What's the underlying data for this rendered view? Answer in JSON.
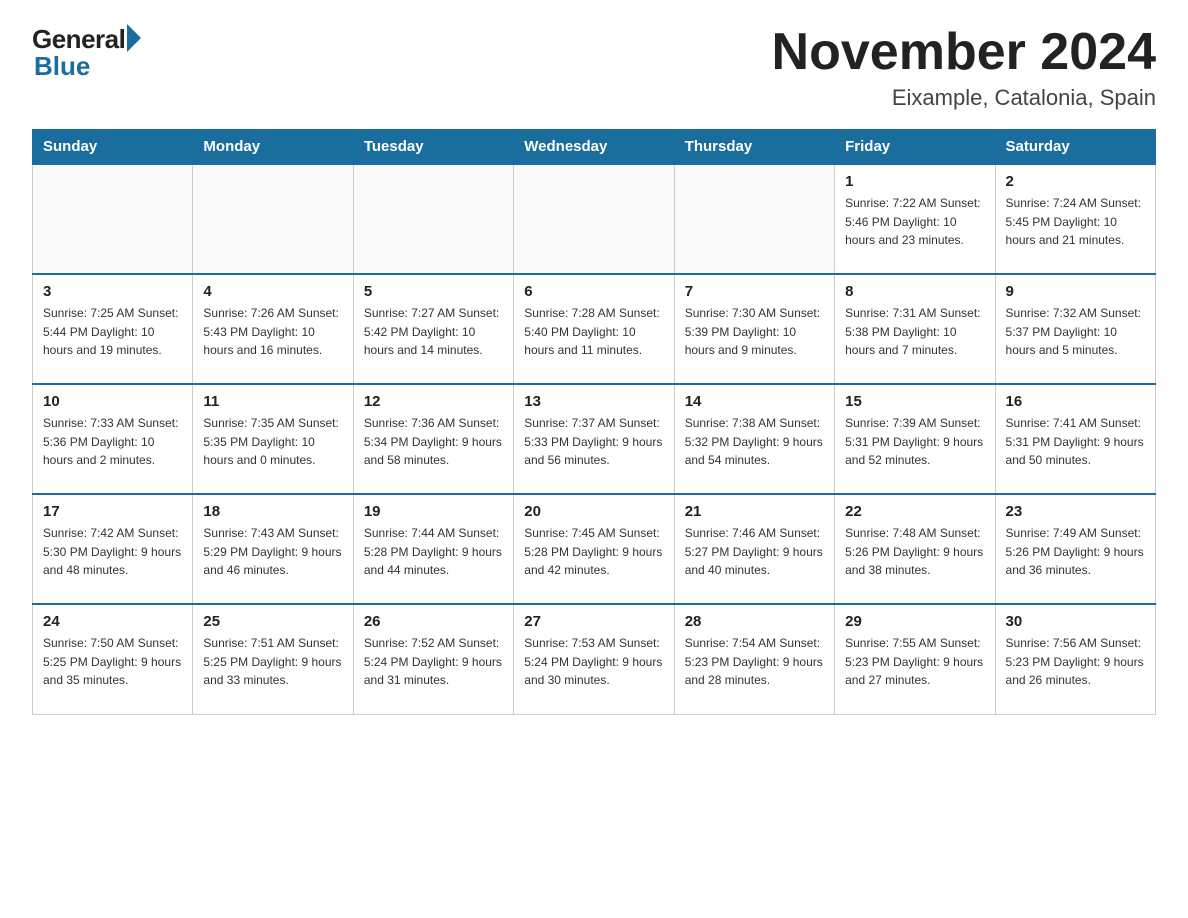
{
  "header": {
    "logo_general": "General",
    "logo_blue": "Blue",
    "month_title": "November 2024",
    "location": "Eixample, Catalonia, Spain"
  },
  "days_of_week": [
    "Sunday",
    "Monday",
    "Tuesday",
    "Wednesday",
    "Thursday",
    "Friday",
    "Saturday"
  ],
  "weeks": [
    [
      {
        "day": "",
        "info": ""
      },
      {
        "day": "",
        "info": ""
      },
      {
        "day": "",
        "info": ""
      },
      {
        "day": "",
        "info": ""
      },
      {
        "day": "",
        "info": ""
      },
      {
        "day": "1",
        "info": "Sunrise: 7:22 AM\nSunset: 5:46 PM\nDaylight: 10 hours\nand 23 minutes."
      },
      {
        "day": "2",
        "info": "Sunrise: 7:24 AM\nSunset: 5:45 PM\nDaylight: 10 hours\nand 21 minutes."
      }
    ],
    [
      {
        "day": "3",
        "info": "Sunrise: 7:25 AM\nSunset: 5:44 PM\nDaylight: 10 hours\nand 19 minutes."
      },
      {
        "day": "4",
        "info": "Sunrise: 7:26 AM\nSunset: 5:43 PM\nDaylight: 10 hours\nand 16 minutes."
      },
      {
        "day": "5",
        "info": "Sunrise: 7:27 AM\nSunset: 5:42 PM\nDaylight: 10 hours\nand 14 minutes."
      },
      {
        "day": "6",
        "info": "Sunrise: 7:28 AM\nSunset: 5:40 PM\nDaylight: 10 hours\nand 11 minutes."
      },
      {
        "day": "7",
        "info": "Sunrise: 7:30 AM\nSunset: 5:39 PM\nDaylight: 10 hours\nand 9 minutes."
      },
      {
        "day": "8",
        "info": "Sunrise: 7:31 AM\nSunset: 5:38 PM\nDaylight: 10 hours\nand 7 minutes."
      },
      {
        "day": "9",
        "info": "Sunrise: 7:32 AM\nSunset: 5:37 PM\nDaylight: 10 hours\nand 5 minutes."
      }
    ],
    [
      {
        "day": "10",
        "info": "Sunrise: 7:33 AM\nSunset: 5:36 PM\nDaylight: 10 hours\nand 2 minutes."
      },
      {
        "day": "11",
        "info": "Sunrise: 7:35 AM\nSunset: 5:35 PM\nDaylight: 10 hours\nand 0 minutes."
      },
      {
        "day": "12",
        "info": "Sunrise: 7:36 AM\nSunset: 5:34 PM\nDaylight: 9 hours\nand 58 minutes."
      },
      {
        "day": "13",
        "info": "Sunrise: 7:37 AM\nSunset: 5:33 PM\nDaylight: 9 hours\nand 56 minutes."
      },
      {
        "day": "14",
        "info": "Sunrise: 7:38 AM\nSunset: 5:32 PM\nDaylight: 9 hours\nand 54 minutes."
      },
      {
        "day": "15",
        "info": "Sunrise: 7:39 AM\nSunset: 5:31 PM\nDaylight: 9 hours\nand 52 minutes."
      },
      {
        "day": "16",
        "info": "Sunrise: 7:41 AM\nSunset: 5:31 PM\nDaylight: 9 hours\nand 50 minutes."
      }
    ],
    [
      {
        "day": "17",
        "info": "Sunrise: 7:42 AM\nSunset: 5:30 PM\nDaylight: 9 hours\nand 48 minutes."
      },
      {
        "day": "18",
        "info": "Sunrise: 7:43 AM\nSunset: 5:29 PM\nDaylight: 9 hours\nand 46 minutes."
      },
      {
        "day": "19",
        "info": "Sunrise: 7:44 AM\nSunset: 5:28 PM\nDaylight: 9 hours\nand 44 minutes."
      },
      {
        "day": "20",
        "info": "Sunrise: 7:45 AM\nSunset: 5:28 PM\nDaylight: 9 hours\nand 42 minutes."
      },
      {
        "day": "21",
        "info": "Sunrise: 7:46 AM\nSunset: 5:27 PM\nDaylight: 9 hours\nand 40 minutes."
      },
      {
        "day": "22",
        "info": "Sunrise: 7:48 AM\nSunset: 5:26 PM\nDaylight: 9 hours\nand 38 minutes."
      },
      {
        "day": "23",
        "info": "Sunrise: 7:49 AM\nSunset: 5:26 PM\nDaylight: 9 hours\nand 36 minutes."
      }
    ],
    [
      {
        "day": "24",
        "info": "Sunrise: 7:50 AM\nSunset: 5:25 PM\nDaylight: 9 hours\nand 35 minutes."
      },
      {
        "day": "25",
        "info": "Sunrise: 7:51 AM\nSunset: 5:25 PM\nDaylight: 9 hours\nand 33 minutes."
      },
      {
        "day": "26",
        "info": "Sunrise: 7:52 AM\nSunset: 5:24 PM\nDaylight: 9 hours\nand 31 minutes."
      },
      {
        "day": "27",
        "info": "Sunrise: 7:53 AM\nSunset: 5:24 PM\nDaylight: 9 hours\nand 30 minutes."
      },
      {
        "day": "28",
        "info": "Sunrise: 7:54 AM\nSunset: 5:23 PM\nDaylight: 9 hours\nand 28 minutes."
      },
      {
        "day": "29",
        "info": "Sunrise: 7:55 AM\nSunset: 5:23 PM\nDaylight: 9 hours\nand 27 minutes."
      },
      {
        "day": "30",
        "info": "Sunrise: 7:56 AM\nSunset: 5:23 PM\nDaylight: 9 hours\nand 26 minutes."
      }
    ]
  ]
}
